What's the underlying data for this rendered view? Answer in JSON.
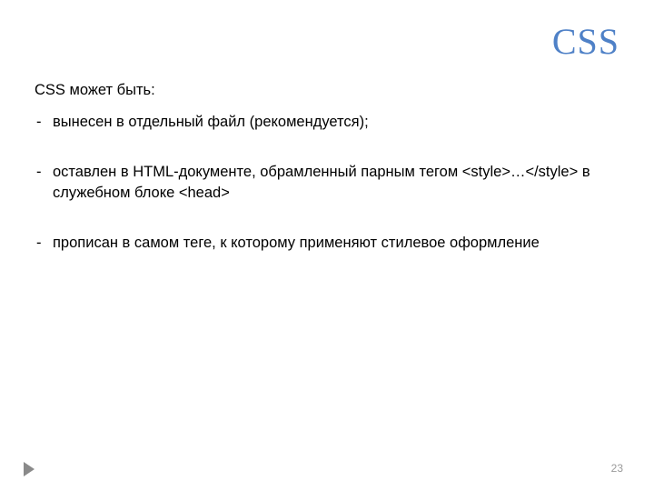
{
  "title": "CSS",
  "intro": "CSS может быть:",
  "bullets": [
    "вынесен в отдельный файл (рекомендуется);",
    "оставлен в HTML-документе, обрамленный парным тегом <style>…</style> в служебном блоке <head>",
    "прописан в самом теге, к которому применяют стилевое оформление"
  ],
  "page_number": "23"
}
